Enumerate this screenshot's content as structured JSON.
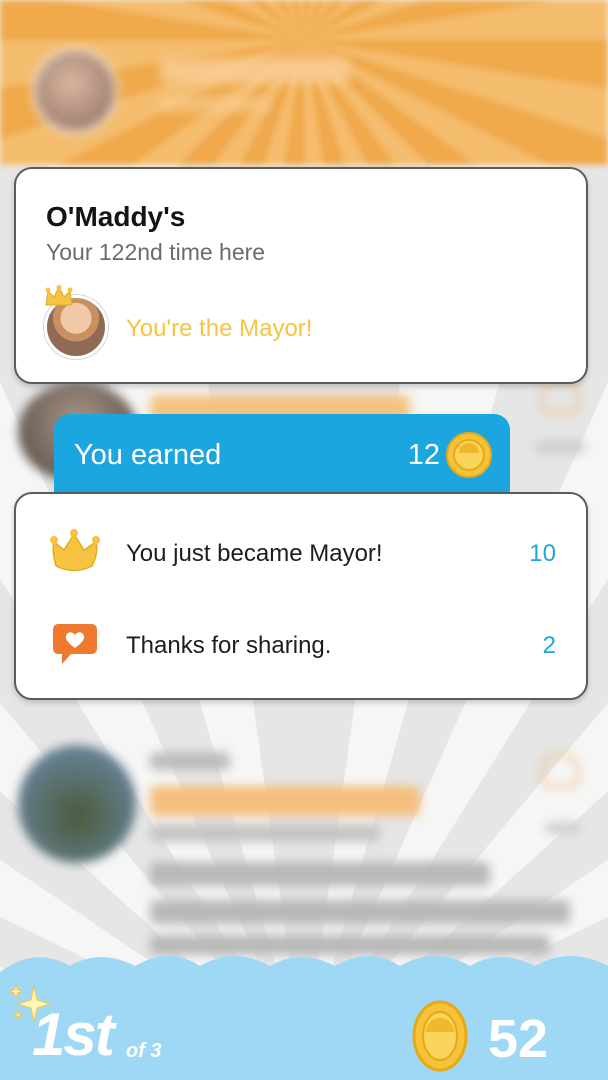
{
  "venue": {
    "name": "O'Maddy's",
    "visit_text": "Your 122nd time here",
    "mayor_text": "You're the Mayor!"
  },
  "earned": {
    "label": "You earned",
    "total": "12"
  },
  "rewards": [
    {
      "icon": "crown-icon",
      "text": "You just became Mayor!",
      "points": "10"
    },
    {
      "icon": "heart-speech-bubble-icon",
      "text": "Thanks for sharing.",
      "points": "2"
    }
  ],
  "leaderboard": {
    "rank": "1st",
    "rank_of": "of 3",
    "coins": "52"
  },
  "colors": {
    "header_orange": "#f0a94b",
    "mayor_yellow": "#f6c442",
    "banner_blue": "#1ba6e0",
    "bottom_sky": "#9fd8f4",
    "coin_gold": "#f5c33b",
    "reward_orange": "#ef7a2f"
  }
}
